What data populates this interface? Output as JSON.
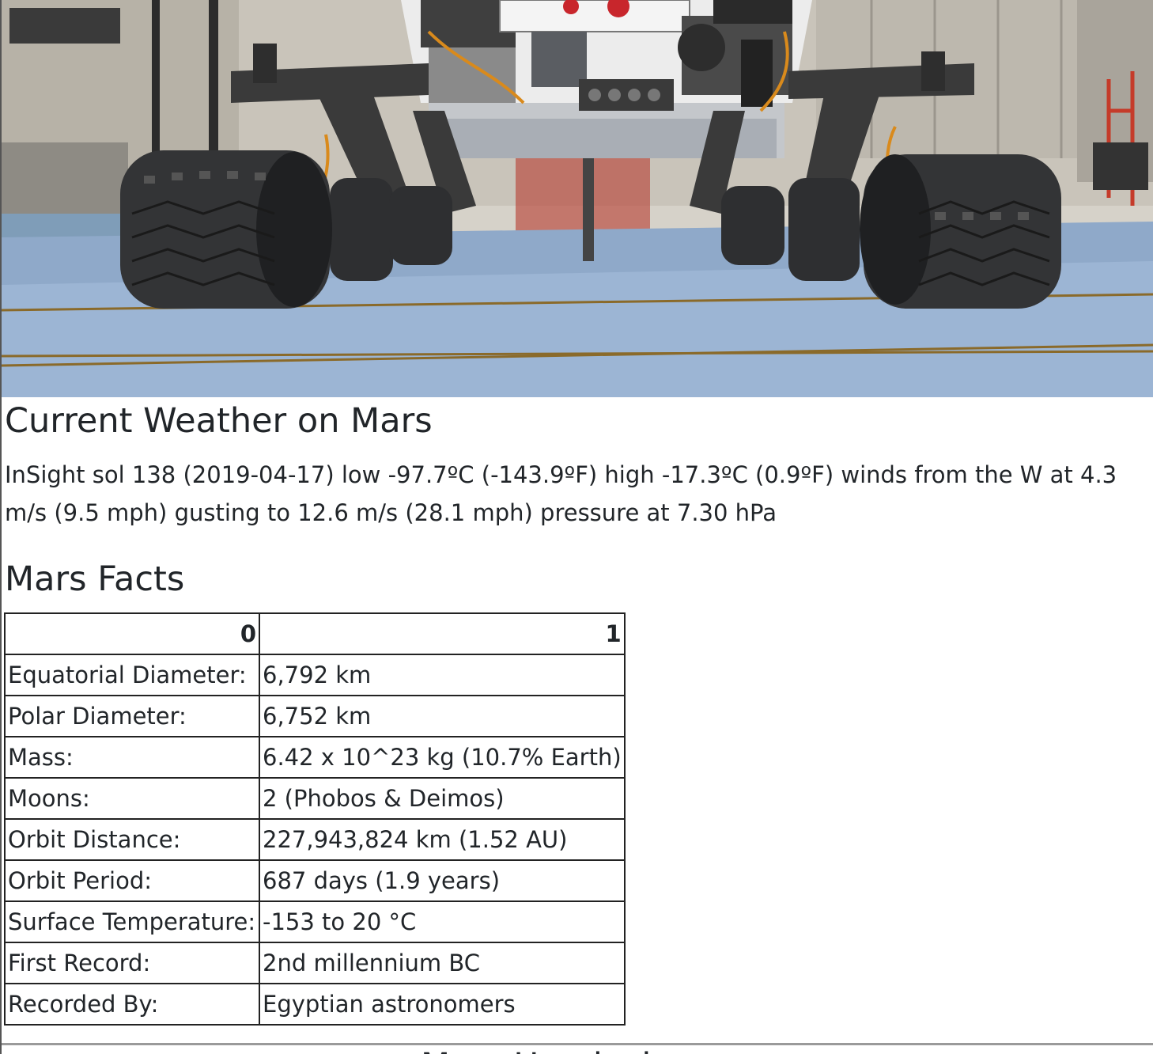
{
  "featured_image": {
    "alt": "Mars rover in clean room"
  },
  "weather": {
    "heading": "Current Weather on Mars",
    "text": "InSight sol 138 (2019-04-17) low -97.7ºC (-143.9ºF) high -17.3ºC (0.9ºF) winds from the W at 4.3 m/s (9.5 mph) gusting to 12.6 m/s (28.1 mph) pressure at 7.30 hPa"
  },
  "facts": {
    "heading": "Mars Facts",
    "columns": [
      "0",
      "1"
    ],
    "rows": [
      [
        "Equatorial Diameter:",
        "6,792 km"
      ],
      [
        "Polar Diameter:",
        "6,752 km"
      ],
      [
        "Mass:",
        "6.42 x 10^23 kg (10.7% Earth)"
      ],
      [
        "Moons:",
        "2 (Phobos & Deimos)"
      ],
      [
        "Orbit Distance:",
        "227,943,824 km (1.52 AU)"
      ],
      [
        "Orbit Period:",
        "687 days (1.9 years)"
      ],
      [
        "Surface Temperature:",
        "-153 to 20 °C"
      ],
      [
        "First Record:",
        "2nd millennium BC"
      ],
      [
        "Recorded By:",
        "Egyptian astronomers"
      ]
    ]
  },
  "hemispheres": {
    "heading": "Mars Hemispheres"
  }
}
